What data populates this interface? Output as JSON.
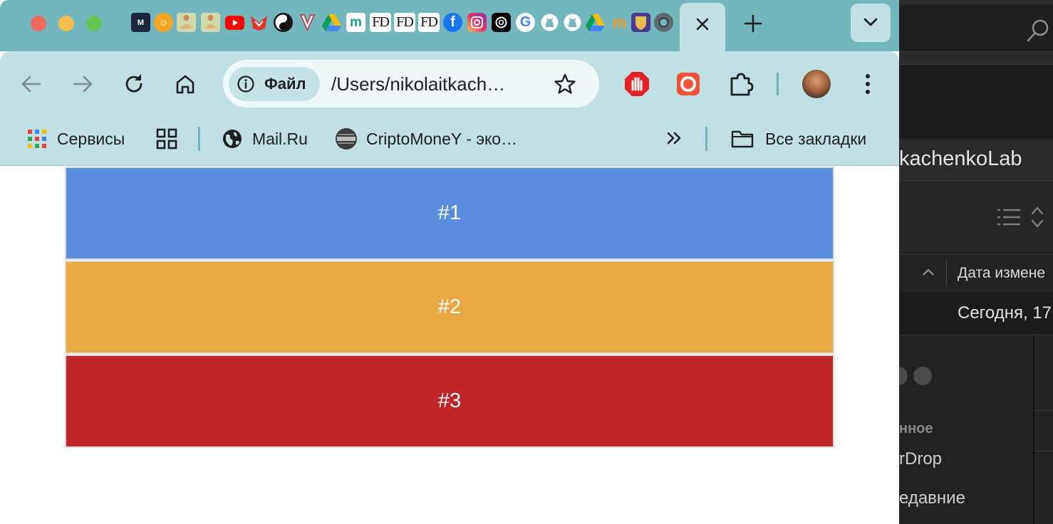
{
  "finder": {
    "path_fragment": "kachenkoLab",
    "column_header": "Дата измене",
    "row_date": "Сегодня, 17",
    "sidebar_section": "нное",
    "sidebar_item_1": "rDrop",
    "sidebar_item_2": "едавние"
  },
  "browser": {
    "tabs": {
      "favicons": [
        "mt-app-icon",
        "coin-icon",
        "meditation-icon",
        "meditation-icon",
        "youtube-icon",
        "fox-icon",
        "yin-yang-icon",
        "v-logo-icon",
        "google-drive-icon",
        "m-app-icon",
        "FD",
        "FD",
        "FD",
        "facebook-icon",
        "instagram-icon",
        "openai-icon",
        "google-icon",
        "github-icon",
        "github-icon",
        "google-drive-icon",
        "mc-icon",
        "crest-icon",
        "chrome-icon"
      ],
      "active_close_icon": "close-icon",
      "new_tab_icon": "plus-icon",
      "tab_search_icon": "chevron-down-icon"
    },
    "toolbar": {
      "site_chip_label": "Файл",
      "url": "/Users/nikolaitkach…"
    },
    "bookmarks": {
      "items": [
        {
          "label": "Сервисы",
          "icon": "apps-grid-icon"
        },
        {
          "label": "",
          "icon": "qr-grid-icon"
        },
        {
          "label": "Mail.Ru",
          "icon": "globe-icon"
        },
        {
          "label": "CriptoMoneY - эко…",
          "icon": "crypto-icon"
        }
      ],
      "overflow_icon": "double-chevron-icon",
      "all_bookmarks": "Все закладки"
    }
  },
  "page": {
    "blocks": [
      {
        "label": "#1",
        "color": "#5b8dde"
      },
      {
        "label": "#2",
        "color": "#eaa842"
      },
      {
        "label": "#3",
        "color": "#bf2628"
      }
    ]
  }
}
